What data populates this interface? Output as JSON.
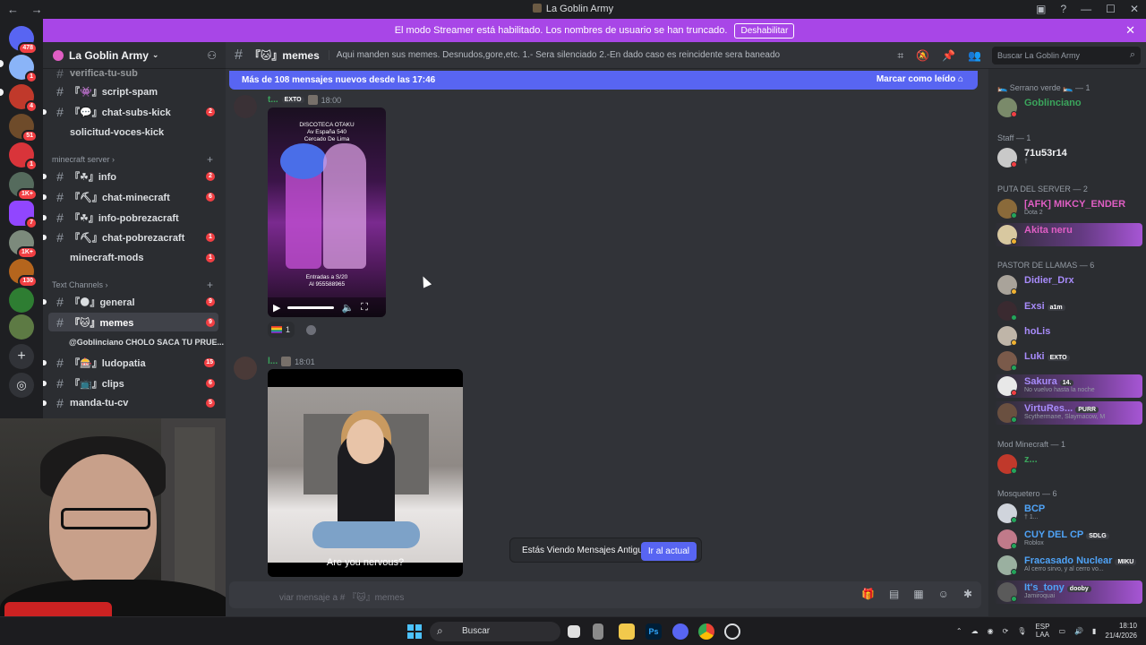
{
  "window": {
    "title": "La Goblin Army"
  },
  "banner": {
    "text": "El modo Streamer está habilitado. Los nombres de usuario se han truncado.",
    "button": "Deshabilitar"
  },
  "rail_badges": [
    "478",
    "1",
    "4",
    "51",
    "1",
    "1K+",
    "7",
    "1K+",
    "130"
  ],
  "guild": {
    "name": "La Goblin Army"
  },
  "channels": {
    "top": [
      {
        "label": "verifica-tu-sub",
        "badge": ""
      },
      {
        "label": "『👾』script-spam",
        "badge": ""
      },
      {
        "label": "『💬』chat-subs-kick",
        "badge": "2"
      },
      {
        "label": "solicitud-voces-kick",
        "badge": ""
      }
    ],
    "cat_minecraft": "minecraft server",
    "minecraft": [
      {
        "label": "『☘』info",
        "badge": "2"
      },
      {
        "label": "『⛏』chat-minecraft",
        "badge": "6"
      },
      {
        "label": "『☘』info-pobrezacraft",
        "badge": ""
      },
      {
        "label": "『⛏』chat-pobrezacraft",
        "badge": "1"
      },
      {
        "label": "minecraft-mods",
        "badge": "1"
      }
    ],
    "cat_text": "Text Channels",
    "text": [
      {
        "label": "『🌑』general",
        "badge": "9"
      },
      {
        "label": "『🐱』memes",
        "badge": "9"
      }
    ],
    "thread": "@Goblinciano CHOLO SACA TU PRUE...",
    "text2": [
      {
        "label": "『🎰』ludopatia",
        "badge": "15"
      },
      {
        "label": "『📺』clips",
        "badge": "6"
      },
      {
        "label": "manda-tu-cv",
        "badge": "5"
      }
    ]
  },
  "chat": {
    "channel": "『🐱』memes",
    "topic": "Aqui manden sus memes. Desnudos,gore,etc. 1.- Sera silenciado 2.-En dado caso es reincidente sera baneado",
    "search_placeholder": "Buscar La Goblin Army",
    "new_messages": "Más de 108 mensajes nuevos desde las 17:46",
    "mark_read": "Marcar como leído",
    "msg1": {
      "user": "t...",
      "tag": "EXTO",
      "time": "18:00",
      "video_text_top": "DISCOTECA OTAKU\nAv España 540\nCercado De Lima",
      "video_text_bottom": "Entradas a S/20\nAl 955588965",
      "reaction_count": "1"
    },
    "msg2": {
      "user": "l...",
      "time": "18:01",
      "subtitle": "Are you nervous?"
    },
    "old_messages": "Estás Viendo Mensajes Antiguos",
    "jump_button": "Ir al actual",
    "composer_placeholder": "viar mensaje a # 『🐱』memes"
  },
  "members": {
    "groups": [
      {
        "title": "🛌 Serrano verde 🛌 — 1"
      },
      {
        "title": "Staff — 1"
      },
      {
        "title": "PUTA DEL SERVER — 2"
      },
      {
        "title": "PASTOR DE LLAMAS — 6"
      },
      {
        "title": "Mod Minecraft — 1"
      },
      {
        "title": "Mosquetero — 6"
      }
    ],
    "list": [
      {
        "name": "Goblinciano",
        "sub": "",
        "tag": "",
        "color": "#3ba55c"
      },
      {
        "name": "71u53r14",
        "sub": "†",
        "tag": "",
        "color": "#f2f3f5"
      },
      {
        "name": "[AFK] MIKCY_ENDER",
        "sub": "Dota 2",
        "tag": "",
        "color": "#e05ec4"
      },
      {
        "name": "Akita neru",
        "sub": "",
        "tag": "",
        "color": "#e05ec4"
      },
      {
        "name": "Didier_Drx",
        "sub": "",
        "tag": "",
        "color": "#a78bfa"
      },
      {
        "name": "Exsi",
        "sub": "",
        "tag": "a1m",
        "color": "#a78bfa"
      },
      {
        "name": "hoLis",
        "sub": "",
        "tag": "",
        "color": "#a78bfa"
      },
      {
        "name": "Luki",
        "sub": "",
        "tag": "EXTO",
        "color": "#a78bfa"
      },
      {
        "name": "Sakura",
        "sub": "No vuelvo hasta la noche",
        "tag": "14.",
        "color": "#a78bfa"
      },
      {
        "name": "VirtuRes...",
        "sub": "Scythermane, Slaymacow, M",
        "tag": "PURR",
        "color": "#a78bfa"
      },
      {
        "name": "z...",
        "sub": "",
        "tag": "",
        "color": "#3ba55c"
      },
      {
        "name": "BCP",
        "sub": "† 1...",
        "tag": "",
        "color": "#4fa3f7"
      },
      {
        "name": "CUY DEL CP",
        "sub": "Roblox",
        "tag": "SDLG",
        "color": "#4fa3f7"
      },
      {
        "name": "Fracasado Nuclear",
        "sub": "Al cerro sirvo, y al cerro vo...",
        "tag": "MIKU",
        "color": "#4fa3f7"
      },
      {
        "name": "It's_tony",
        "sub": "Jamiroquai",
        "tag": "dooby",
        "color": "#4fa3f7"
      }
    ]
  },
  "taskbar": {
    "search": "Buscar",
    "lang_top": "ESP",
    "lang_bottom": "LAA",
    "time": "18:10",
    "date": "21/4/2026"
  }
}
